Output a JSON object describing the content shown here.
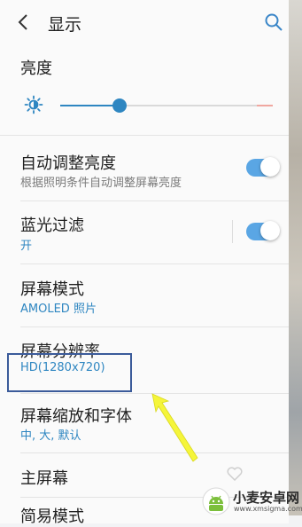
{
  "header": {
    "title": "显示"
  },
  "brightness": {
    "label": "亮度",
    "value": 0.28
  },
  "items": [
    {
      "label": "自动调整亮度",
      "sub": "根据照明条件自动调整屏幕亮度"
    },
    {
      "label": "蓝光过滤",
      "sub": "开"
    },
    {
      "label": "屏幕模式",
      "sub": "AMOLED 照片"
    },
    {
      "label": "屏幕分辨率",
      "sub": "HD(1280x720)"
    },
    {
      "label": "屏幕缩放和字体",
      "sub": "中, 大, 默认"
    },
    {
      "label": "主屏幕"
    },
    {
      "label": "简易模式"
    }
  ],
  "watermark": {
    "main": "小麦安卓网",
    "sub": "www.xmsigma.com"
  },
  "colors": {
    "accent": "#2e86c1",
    "toggle": "#5aa6e4",
    "highlight_box": "#3b5b9a",
    "arrow": "#f5f53a"
  }
}
